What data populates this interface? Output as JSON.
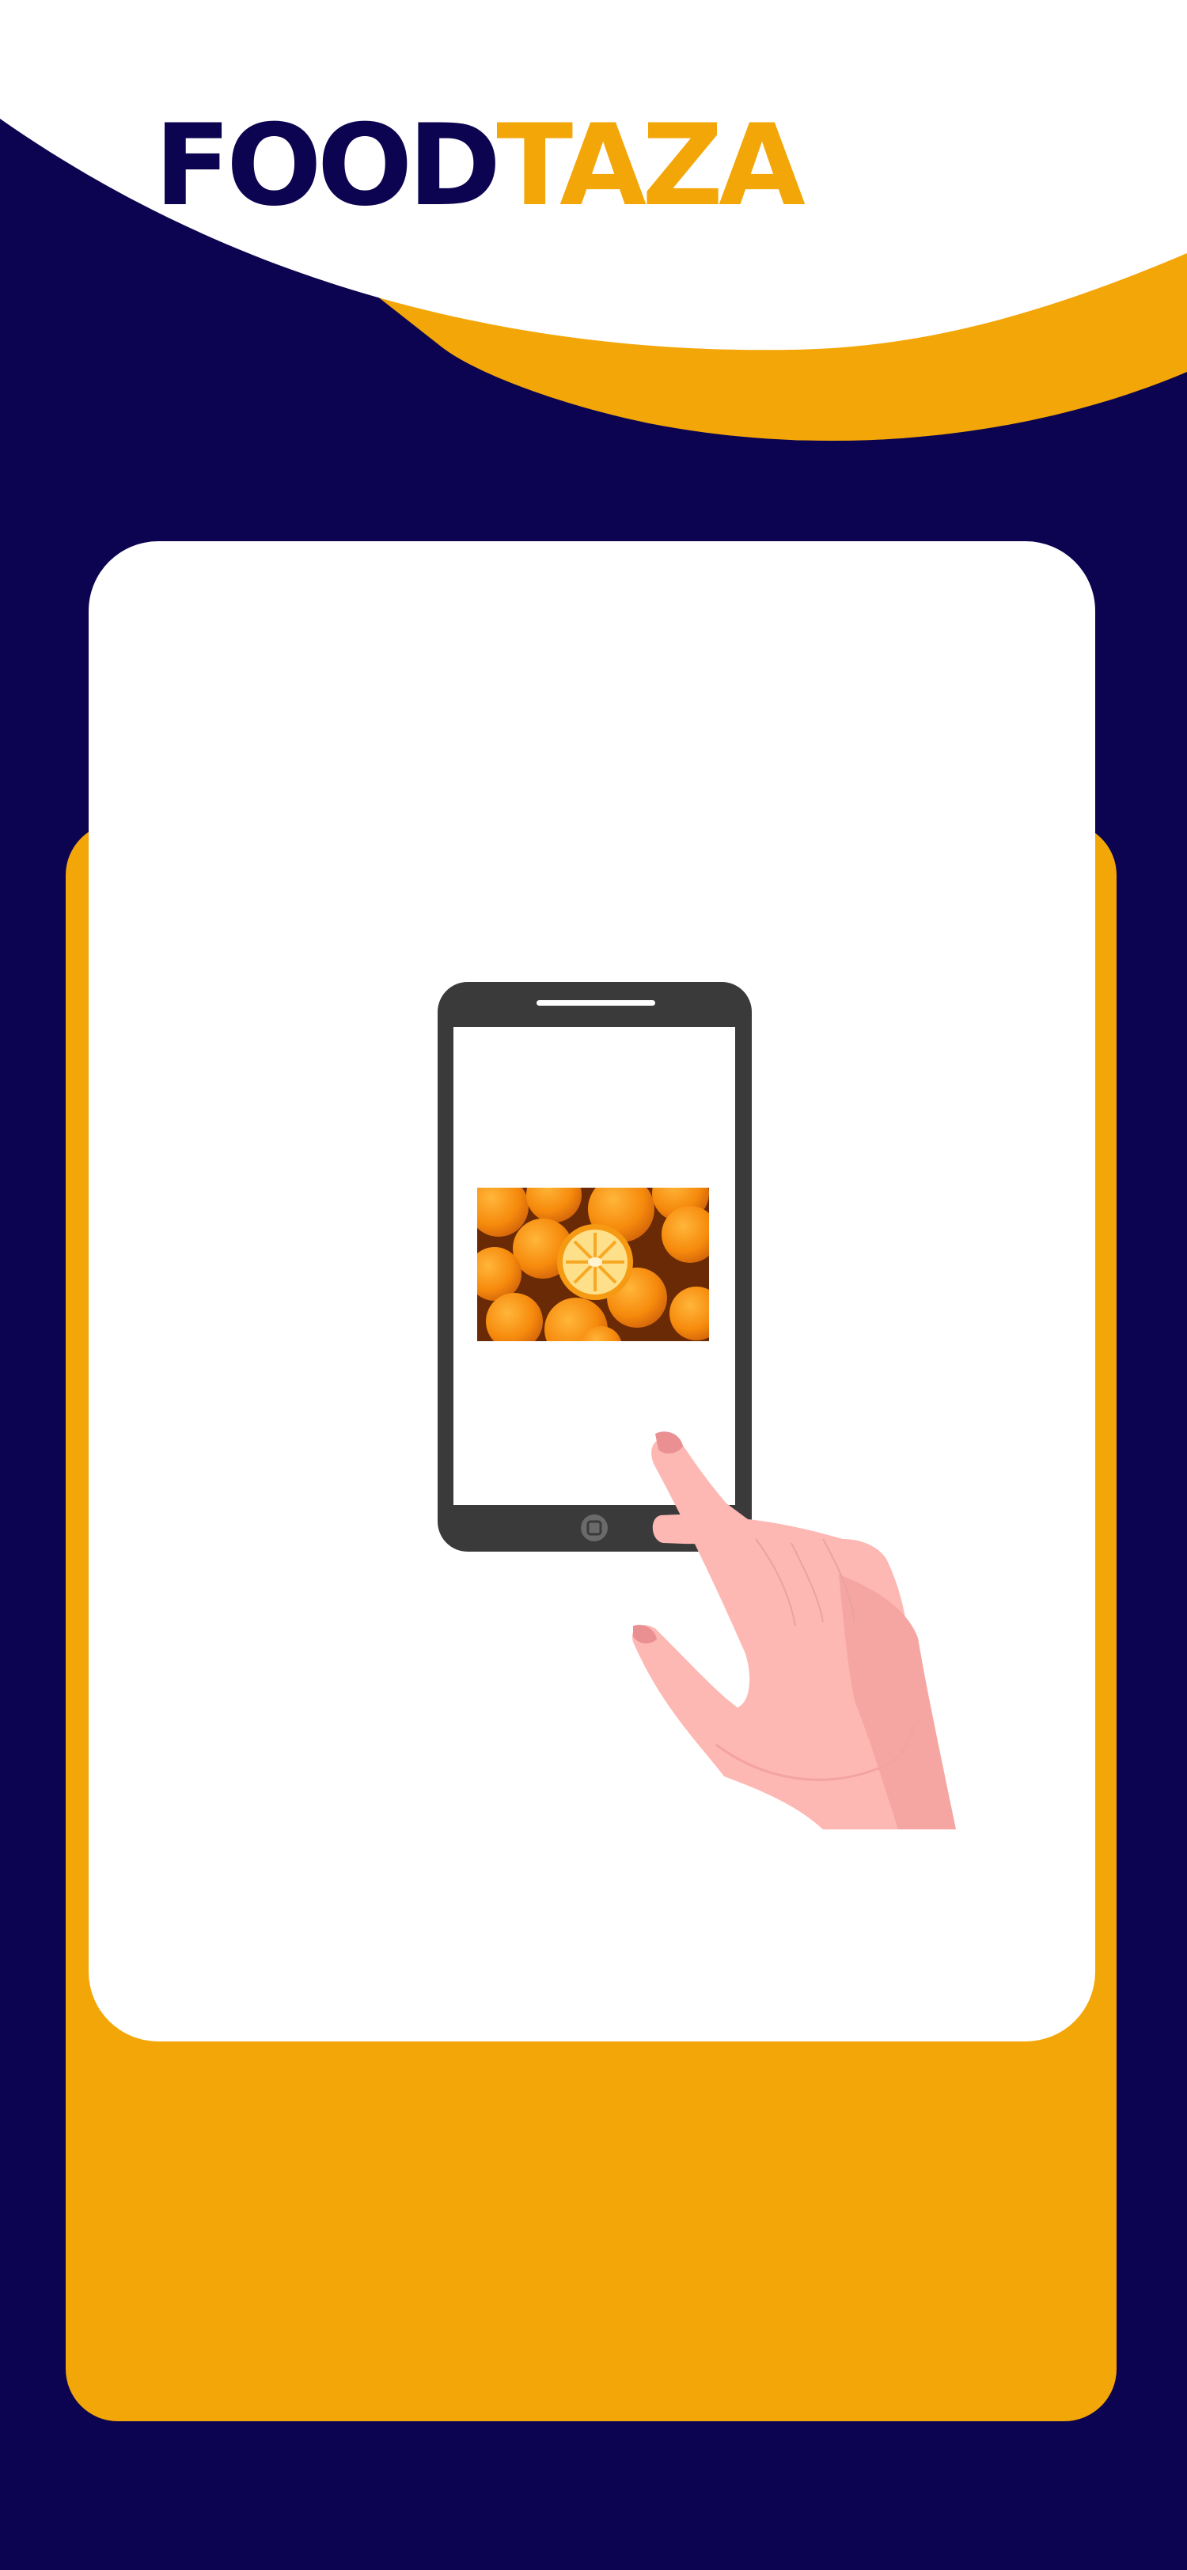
{
  "app": {
    "brand_primary": "FOOD",
    "brand_accent": "TAZA"
  },
  "colors": {
    "navy": "#0c0450",
    "orange": "#f3a608",
    "white": "#ffffff",
    "phone": "#3a3a3a",
    "skin": "#fdb8b4"
  },
  "illustration": {
    "device": "smartphone-icon",
    "screen_image": "oranges-photo",
    "gesture": "tap-hand-icon"
  }
}
